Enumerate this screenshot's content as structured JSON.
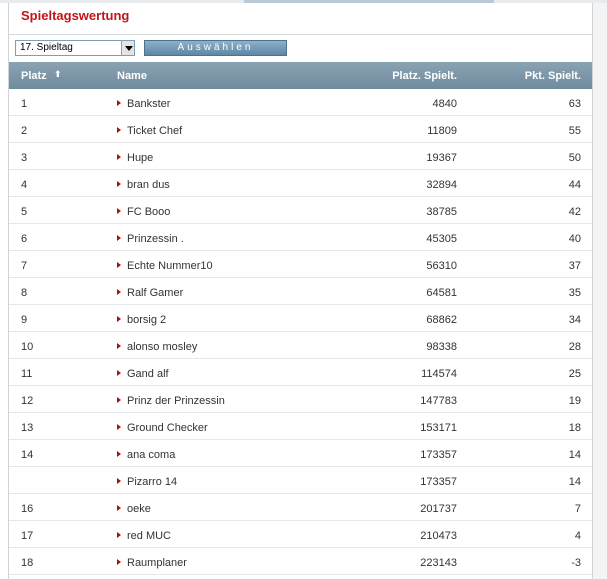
{
  "title": "Spieltagswertung",
  "matchday_select": {
    "selected": "17. Spieltag"
  },
  "select_button": {
    "label": "Auswählen"
  },
  "table": {
    "headers": {
      "platz": "Platz",
      "sort_icon": "⬆",
      "name": "Name",
      "platz_spielt": "Platz. Spielt.",
      "pkt_spielt": "Pkt. Spielt."
    },
    "rows": [
      {
        "rank": "1",
        "name": "Bankster",
        "platz": "4840",
        "pkt": "63"
      },
      {
        "rank": "2",
        "name": "Ticket Chef",
        "platz": "11809",
        "pkt": "55"
      },
      {
        "rank": "3",
        "name": "Hupe",
        "platz": "19367",
        "pkt": "50"
      },
      {
        "rank": "4",
        "name": "bran dus",
        "platz": "32894",
        "pkt": "44"
      },
      {
        "rank": "5",
        "name": "FC Booo",
        "platz": "38785",
        "pkt": "42"
      },
      {
        "rank": "6",
        "name": "Prinzessin .",
        "platz": "45305",
        "pkt": "40"
      },
      {
        "rank": "7",
        "name": "Echte Nummer10",
        "platz": "56310",
        "pkt": "37"
      },
      {
        "rank": "8",
        "name": "Ralf Gamer",
        "platz": "64581",
        "pkt": "35"
      },
      {
        "rank": "9",
        "name": "borsig 2",
        "platz": "68862",
        "pkt": "34"
      },
      {
        "rank": "10",
        "name": "alonso mosley",
        "platz": "98338",
        "pkt": "28"
      },
      {
        "rank": "11",
        "name": "Gand alf",
        "platz": "114574",
        "pkt": "25"
      },
      {
        "rank": "12",
        "name": "Prinz der Prinzessin",
        "platz": "147783",
        "pkt": "19"
      },
      {
        "rank": "13",
        "name": "Ground Checker",
        "platz": "153171",
        "pkt": "18"
      },
      {
        "rank": "14",
        "name": "ana coma",
        "platz": "173357",
        "pkt": "14"
      },
      {
        "rank": "",
        "name": "Pizarro 14",
        "platz": "173357",
        "pkt": "14"
      },
      {
        "rank": "16",
        "name": "oeke",
        "platz": "201737",
        "pkt": "7"
      },
      {
        "rank": "17",
        "name": "red MUC",
        "platz": "210473",
        "pkt": "4"
      },
      {
        "rank": "18",
        "name": "Raumplaner",
        "platz": "223143",
        "pkt": "-3"
      }
    ]
  }
}
